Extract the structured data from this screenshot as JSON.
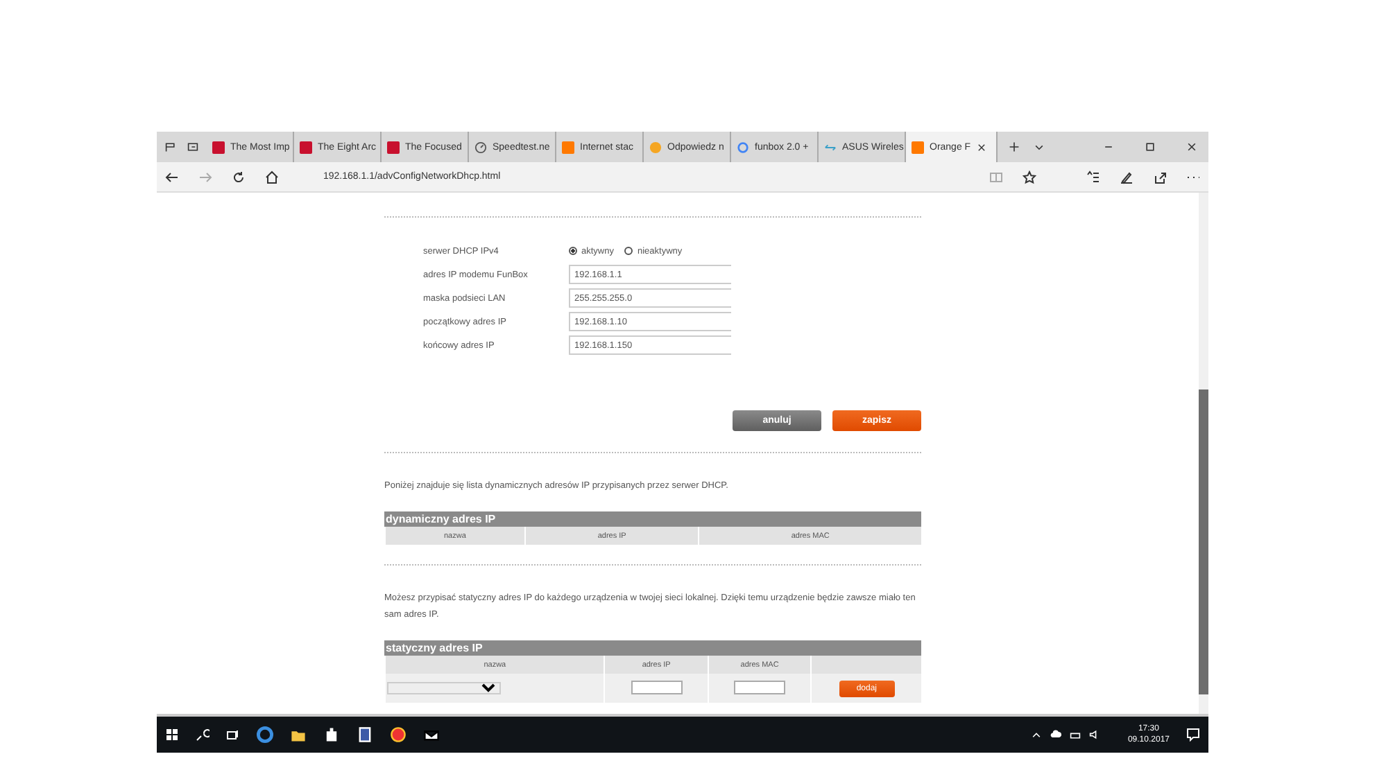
{
  "browser": {
    "tabs": [
      {
        "label": "The Most Imp",
        "kind": "news",
        "selected": false
      },
      {
        "label": "The Eight Arc",
        "kind": "news",
        "selected": false
      },
      {
        "label": "The Focused",
        "kind": "news",
        "selected": false
      },
      {
        "label": "Speedtest.ne",
        "kind": "gauge",
        "selected": false
      },
      {
        "label": "Internet stac",
        "kind": "square",
        "selected": false
      },
      {
        "label": "Odpowiedz n",
        "kind": "circle",
        "selected": false
      },
      {
        "label": "funbox 2.0 +",
        "kind": "g",
        "selected": false
      },
      {
        "label": "ASUS Wireles",
        "kind": "arrows",
        "selected": false
      },
      {
        "label": "Orange F",
        "kind": "square",
        "selected": true
      }
    ],
    "address": "192.168.1.1/advConfigNetworkDhcp.html"
  },
  "dhcp_form": {
    "fields": [
      {
        "label": "serwer DHCP IPv4",
        "kind": "radio",
        "options": [
          {
            "label": "aktywny",
            "selected": true
          },
          {
            "label": "nieaktywny",
            "selected": false
          }
        ]
      },
      {
        "label": "adres IP modemu FunBox",
        "kind": "text",
        "value": "192.168.1.1"
      },
      {
        "label": "maska podsieci LAN",
        "kind": "text",
        "value": "255.255.255.0"
      },
      {
        "label": "początkowy adres IP",
        "kind": "text",
        "value": "192.168.1.10"
      },
      {
        "label": "końcowy adres IP",
        "kind": "text",
        "value": "192.168.1.150"
      }
    ],
    "buttons": [
      {
        "label": "anuluj",
        "kind": "secondary"
      },
      {
        "label": "zapisz",
        "kind": "primary"
      }
    ]
  },
  "dynamic_section": {
    "description": "Poniżej znajduje się lista dynamicznych adresów IP przypisanych przez serwer DHCP.",
    "table": {
      "title": "dynamiczny adres IP",
      "columns": [
        "nazwa",
        "adres IP",
        "adres MAC"
      ]
    }
  },
  "static_section": {
    "description": "Możesz przypisać statyczny adres IP do każdego urządzenia w twojej sieci lokalnej. Dzięki temu urządzenie będzie zawsze miało ten sam adres IP.",
    "table": {
      "title": "statyczny adres IP",
      "columns": [
        "nazwa",
        "adres IP",
        "adres MAC"
      ],
      "add_button": "dodaj"
    }
  },
  "taskbar": {
    "time": "17:30",
    "date": "09.10.2017"
  }
}
